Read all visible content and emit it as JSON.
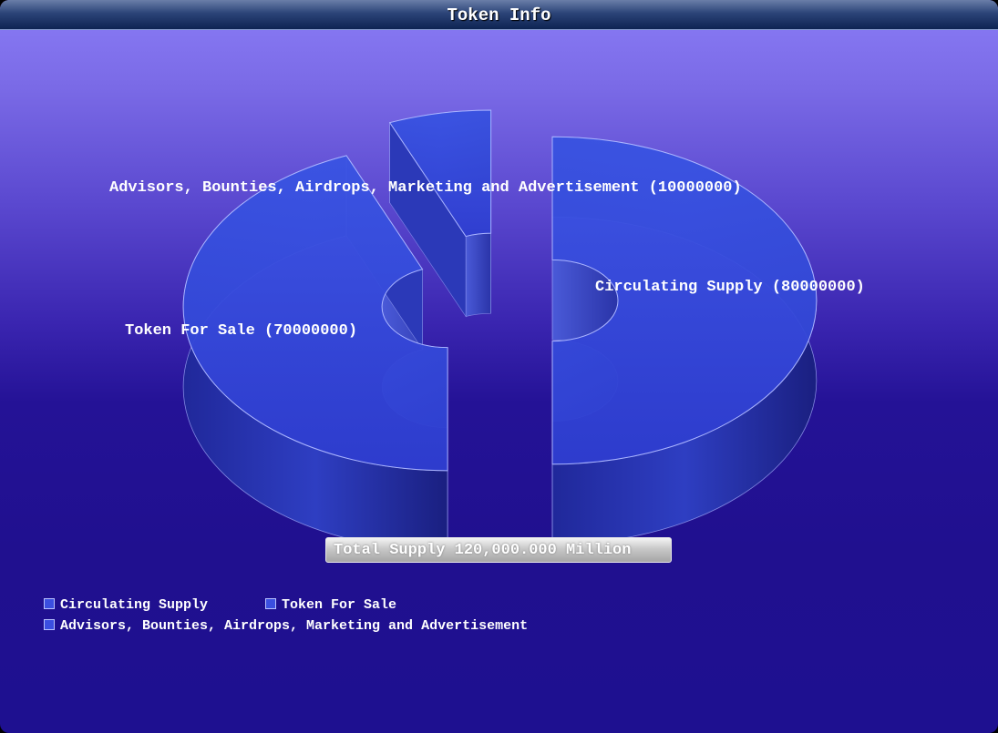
{
  "window": {
    "title": "Token Info"
  },
  "chart_data": {
    "type": "pie",
    "style": "3d-exploded-donut",
    "title": "Token Info",
    "slices": [
      {
        "label": "Circulating Supply",
        "value": 80000000,
        "display": "Circulating Supply  (80000000)"
      },
      {
        "label": "Token For Sale",
        "value": 70000000,
        "display": "Token For Sale  (70000000)"
      },
      {
        "label": "Advisors, Bounties, Airdrops, Marketing and Advertisement",
        "value": 10000000,
        "display": "Advisors, Bounties, Airdrops, Marketing and Advertisement (10000000)"
      }
    ],
    "annotation": "Total Supply 120,000.000 Million",
    "legend_position": "bottom-left",
    "colors": {
      "slice_fill": "#3b4fe0",
      "slice_edge": "#aab4ff"
    }
  },
  "legend": {
    "items": [
      {
        "label": "Circulating Supply",
        "icon": "square-swatch"
      },
      {
        "label": "Token For Sale",
        "icon": "square-swatch"
      },
      {
        "label": "Advisors, Bounties, Airdrops, Marketing and Advertisement",
        "icon": "square-swatch"
      }
    ]
  }
}
